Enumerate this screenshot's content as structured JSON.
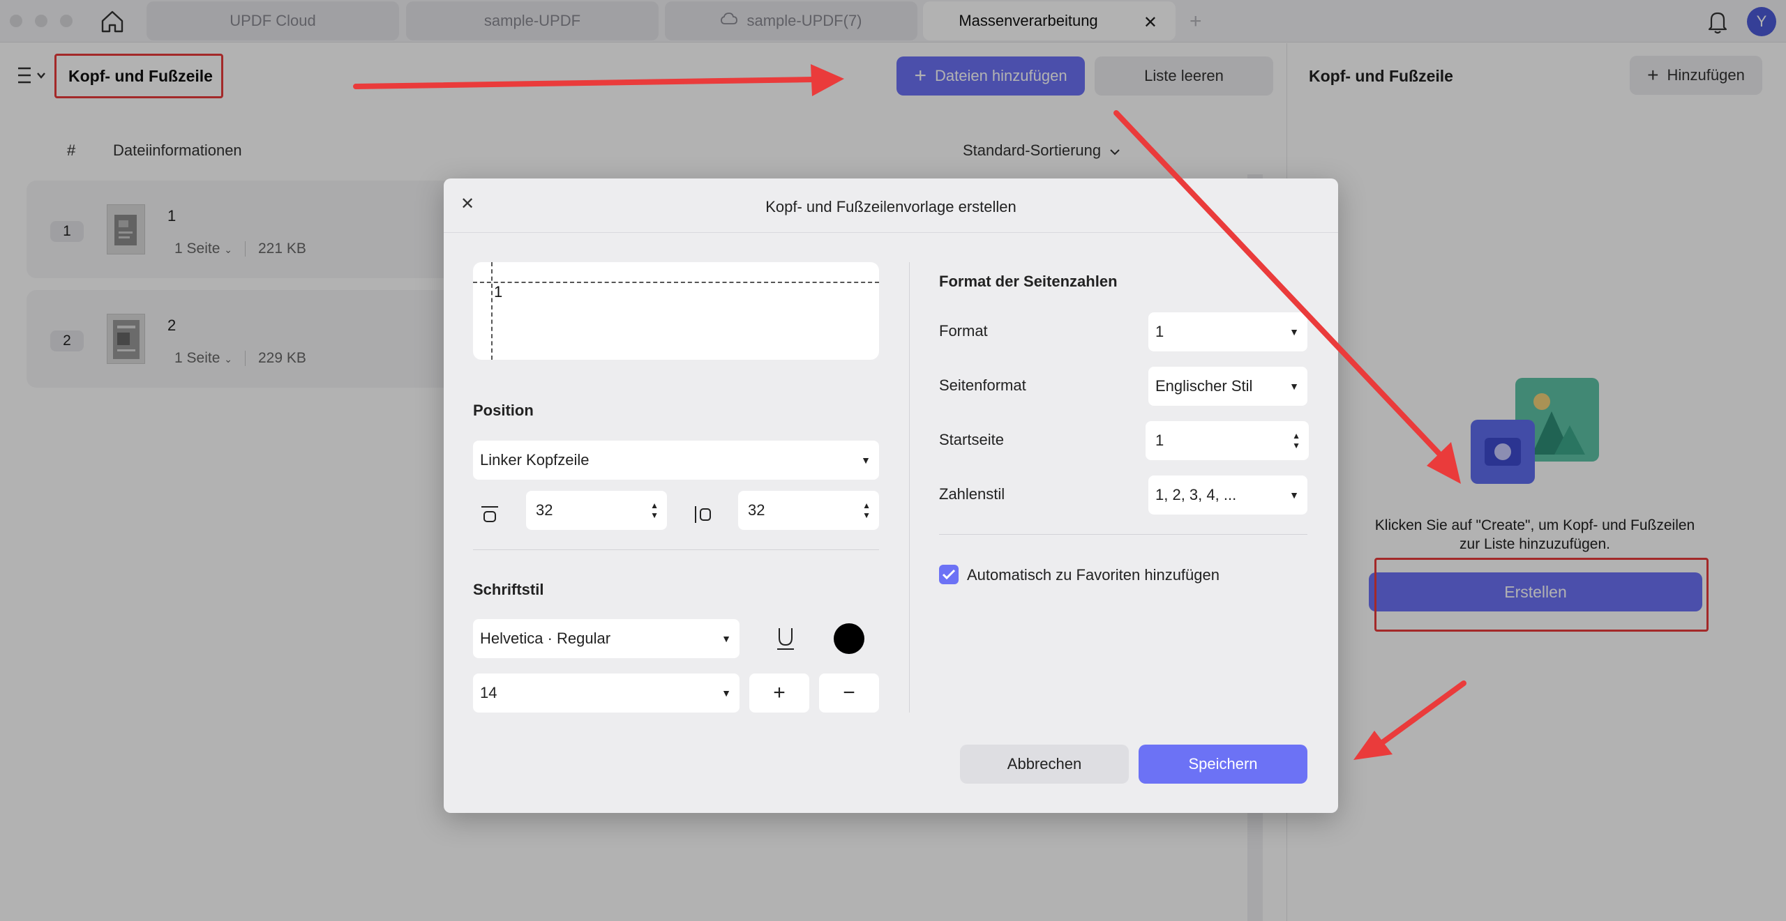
{
  "tabs": [
    {
      "label": "UPDF Cloud"
    },
    {
      "label": "sample-UPDF"
    },
    {
      "label": "sample-UPDF(7)"
    },
    {
      "label": "Massenverarbeitung"
    }
  ],
  "user": {
    "initial": "Y"
  },
  "toolbar": {
    "section_title": "Kopf- und Fußzeile",
    "add_files_label": "Dateien hinzufügen",
    "clear_list_label": "Liste leeren"
  },
  "file_list": {
    "col_number": "#",
    "col_info": "Dateiinformationen",
    "sort_label": "Standard-Sortierung",
    "rows": [
      {
        "num": "1",
        "name": "1",
        "pages": "1 Seite",
        "size": "221 KB"
      },
      {
        "num": "2",
        "name": "2",
        "pages": "1 Seite",
        "size": "229 KB"
      }
    ]
  },
  "right_panel": {
    "title": "Kopf- und Fußzeile",
    "add_label": "Hinzufügen",
    "hint": "Klicken Sie auf \"Create\", um Kopf- und Fußzeilen zur Liste hinzuzufügen.",
    "create_label": "Erstellen"
  },
  "dialog": {
    "title": "Kopf- und Fußzeilenvorlage erstellen",
    "preview_number": "1",
    "position_title": "Position",
    "position_value": "Linker Kopfzeile",
    "margin_top": "32",
    "margin_side": "32",
    "font_title": "Schriftstil",
    "font_value": "Helvetica · Regular",
    "font_size": "14",
    "text_color": "#000000",
    "page_number_title": "Format der Seitenzahlen",
    "format_label": "Format",
    "format_value": "1",
    "page_format_label": "Seitenformat",
    "page_format_value": "Englischer Stil",
    "start_page_label": "Startseite",
    "start_page_value": "1",
    "number_style_label": "Zahlenstil",
    "number_style_value": "1, 2, 3, 4, ...",
    "auto_favorite_label": "Automatisch zu Favoriten hinzufügen",
    "auto_favorite_checked": true,
    "cancel_label": "Abbrechen",
    "save_label": "Speichern"
  },
  "colors": {
    "accent": "#6c72f5",
    "annotation_red": "#ea3b3b",
    "avatar": "#4d5bd8"
  }
}
